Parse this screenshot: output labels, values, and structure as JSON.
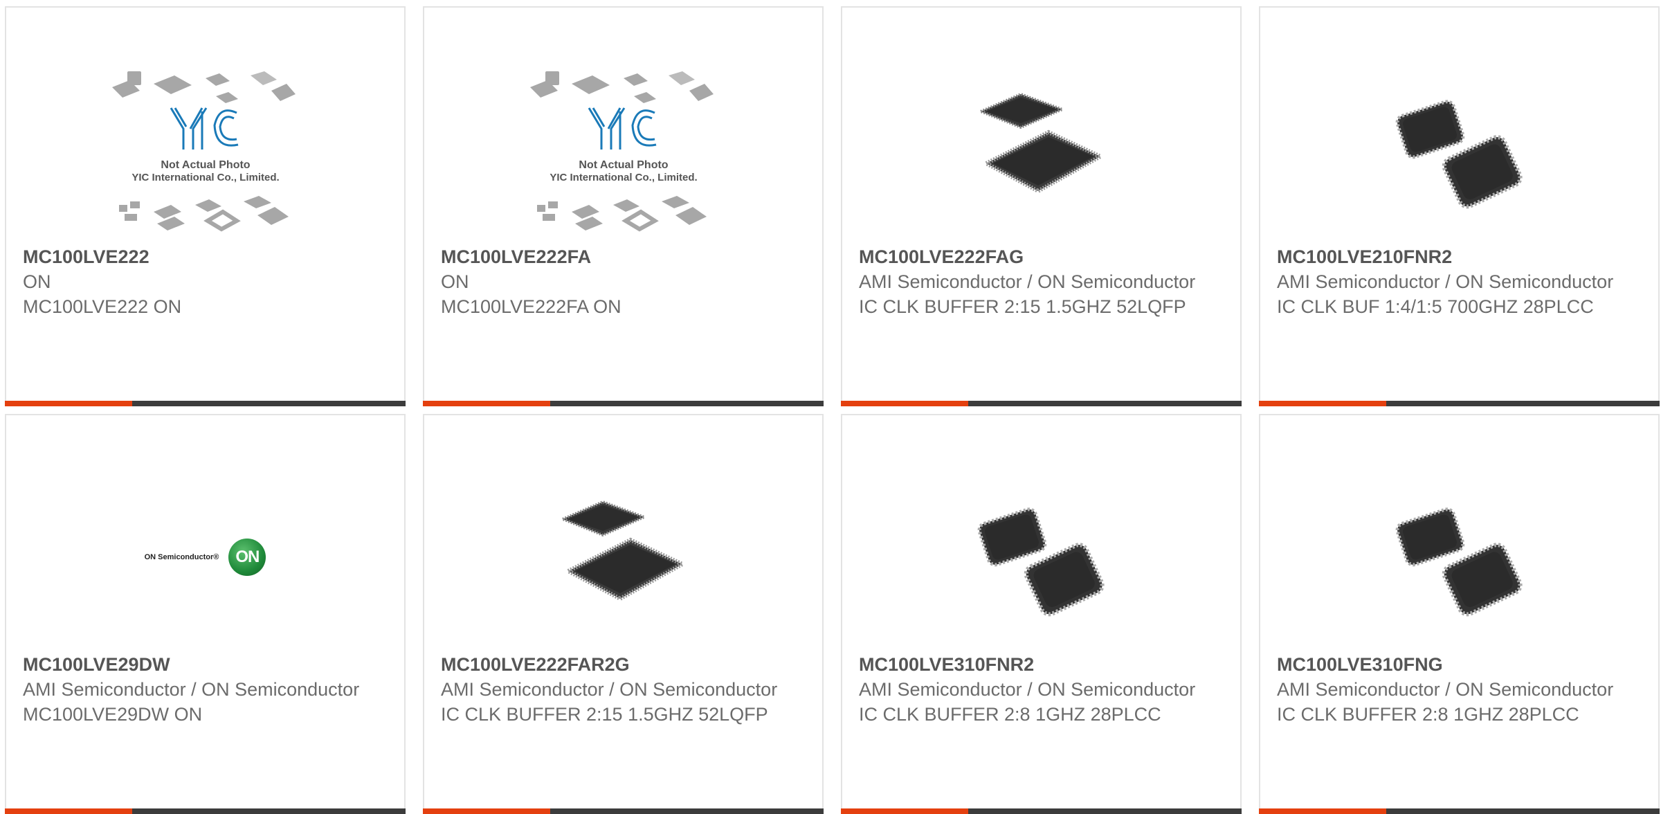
{
  "products": [
    {
      "part": "MC100LVE222",
      "maker": "ON",
      "desc": "MC100LVE222 ON",
      "image": "yic-not-actual-photo",
      "image_text": {
        "line1": "Not Actual Photo",
        "line2": "YIC International Co., Limited.",
        "logo": "YIC"
      }
    },
    {
      "part": "MC100LVE222FA",
      "maker": "ON",
      "desc": "MC100LVE222FA ON",
      "image": "yic-not-actual-photo",
      "image_text": {
        "line1": "Not Actual Photo",
        "line2": "YIC International Co., Limited.",
        "logo": "YIC"
      }
    },
    {
      "part": "MC100LVE222FAG",
      "maker": "AMI Semiconductor / ON Semiconductor",
      "desc": "IC CLK BUFFER 2:15 1.5GHZ 52LQFP",
      "image": "lqfp-chip-photo"
    },
    {
      "part": "MC100LVE210FNR2",
      "maker": "AMI Semiconductor / ON Semiconductor",
      "desc": "IC CLK BUF 1:4/1:5 700GHZ 28PLCC",
      "image": "plcc-chip-photo"
    },
    {
      "part": "MC100LVE29DW",
      "maker": "AMI Semiconductor / ON Semiconductor",
      "desc": "MC100LVE29DW ON",
      "image": "on-semiconductor-logo",
      "image_text": {
        "brand": "ON Semiconductor®",
        "badge": "ON"
      }
    },
    {
      "part": "MC100LVE222FAR2G",
      "maker": "AMI Semiconductor / ON Semiconductor",
      "desc": "IC CLK BUFFER 2:15 1.5GHZ 52LQFP",
      "image": "lqfp-chip-photo"
    },
    {
      "part": "MC100LVE310FNR2",
      "maker": "AMI Semiconductor / ON Semiconductor",
      "desc": "IC CLK BUFFER 2:8 1GHZ 28PLCC",
      "image": "plcc-chip-photo"
    },
    {
      "part": "MC100LVE310FNG",
      "maker": "AMI Semiconductor / ON Semiconductor",
      "desc": "IC CLK BUFFER 2:8 1GHZ 28PLCC",
      "image": "plcc-chip-photo"
    }
  ],
  "colors": {
    "accent": "#e4400f",
    "bar": "#3c3c3c",
    "border": "#e3e3e3",
    "text": "#6b6b6b",
    "on_green": "#1f8a3a",
    "yic_blue": "#1a7ab8"
  }
}
